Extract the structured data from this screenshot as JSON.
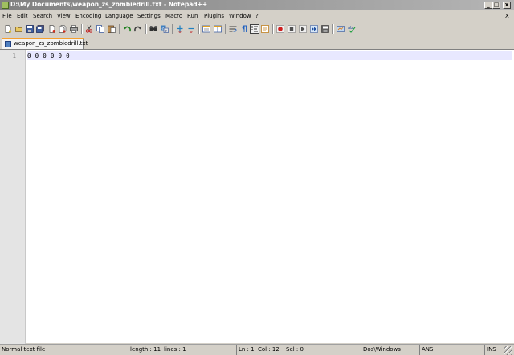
{
  "window": {
    "title": "D:\\My Documents\\weapon_zs_zombiedrill.txt - Notepad++",
    "min_glyph": "_",
    "max_glyph": "□",
    "close_glyph": "x"
  },
  "menu": {
    "items": [
      "File",
      "Edit",
      "Search",
      "View",
      "Encoding",
      "Language",
      "Settings",
      "Macro",
      "Run",
      "Plugins",
      "Window",
      "?"
    ],
    "close_glyph": "X"
  },
  "toolbar": {
    "icons": [
      "new-file-icon",
      "open-file-icon",
      "save-icon",
      "save-all-icon",
      "close-icon",
      "close-all-icon",
      "print-icon",
      "cut-icon",
      "copy-icon",
      "paste-icon",
      "undo-icon",
      "redo-icon",
      "find-icon",
      "replace-icon",
      "zoom-in-icon",
      "zoom-out-icon",
      "sync-vertical-icon",
      "sync-horizontal-icon",
      "word-wrap-icon",
      "show-all-chars-icon",
      "indent-guide-icon",
      "user-language-icon",
      "record-macro-icon",
      "stop-record-icon",
      "play-macro-icon",
      "run-macro-multiple-icon",
      "save-macro-icon",
      "launch-browser-icon",
      "spellcheck-icon"
    ]
  },
  "tabs": [
    {
      "label": "weapon_zs_zombiedrill.txt"
    }
  ],
  "editor": {
    "lines": [
      {
        "number": "1",
        "text": "0 0 0 0 0 0"
      }
    ]
  },
  "status": {
    "file_type": "Normal text file",
    "length": "length : 11",
    "lines": "lines : 1",
    "ln": "Ln : 1",
    "col": "Col : 12",
    "sel": "Sel : 0",
    "eol": "Dos\\Windows",
    "encoding": "ANSI",
    "mode": "INS"
  },
  "colors": {
    "tab_accent": "#f5a030",
    "current_line": "#e8e8ff",
    "gutter": "#e4e4e4"
  }
}
